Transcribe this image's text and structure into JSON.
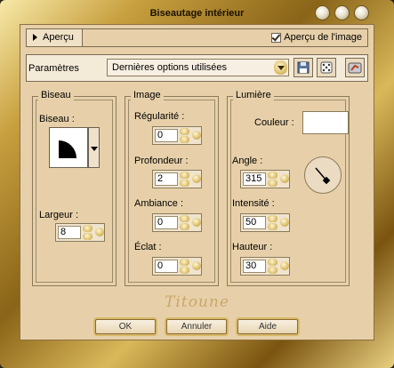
{
  "window": {
    "title": "Biseautage intérieur"
  },
  "toolbar": {
    "preview_toggle_label": "Aperçu",
    "preview_checkbox_label": "Aperçu de l'image",
    "preview_checked": true
  },
  "params": {
    "label": "Paramètres",
    "preset_value": "Dernières options utilisées"
  },
  "groups": {
    "biseau": {
      "title": "Biseau",
      "bevel_label": "Biseau :",
      "width_label": "Largeur :",
      "width_value": "8"
    },
    "image": {
      "title": "Image",
      "smoothness_label": "Régularité :",
      "smoothness_value": "0",
      "depth_label": "Profondeur :",
      "depth_value": "2",
      "ambience_label": "Ambiance :",
      "ambience_value": "0",
      "shininess_label": "Éclat :",
      "shininess_value": "0"
    },
    "light": {
      "title": "Lumière",
      "color_label": "Couleur :",
      "color_value": "#ffffff",
      "angle_label": "Angle :",
      "angle_value": "315",
      "intensity_label": "Intensité :",
      "intensity_value": "50",
      "height_label": "Hauteur :",
      "height_value": "30"
    }
  },
  "signature": "Titoune",
  "buttons": {
    "ok": "OK",
    "cancel": "Annuler",
    "help": "Aide"
  }
}
